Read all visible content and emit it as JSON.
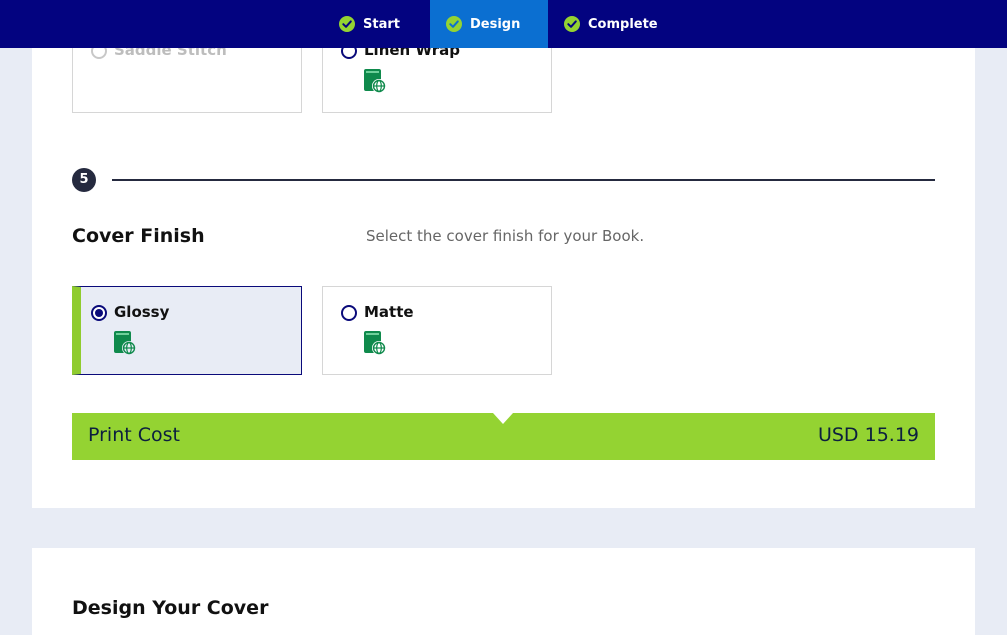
{
  "steps": [
    {
      "label": "Start",
      "active": false
    },
    {
      "label": "Design",
      "active": true
    },
    {
      "label": "Complete",
      "active": false
    }
  ],
  "binding_options": [
    {
      "label": "Saddle Stitch",
      "state": "disabled"
    },
    {
      "label": "Linen Wrap",
      "state": "unselected"
    }
  ],
  "cover_finish": {
    "step_number": "5",
    "title": "Cover Finish",
    "description": "Select the cover finish for your Book.",
    "options": [
      {
        "label": "Glossy",
        "state": "selected"
      },
      {
        "label": "Matte",
        "state": "unselected"
      }
    ]
  },
  "print_cost": {
    "label": "Print Cost",
    "value": "USD 15.19"
  },
  "design_cover": {
    "title": "Design Your Cover"
  },
  "colors": {
    "nav_bg": "#030380",
    "nav_active": "#0b6fd1",
    "accent_green": "#94d332",
    "icon_green": "#0f8a4c"
  },
  "icons": {
    "step_check": "check-circle-icon",
    "option_book": "book-globe-icon"
  }
}
